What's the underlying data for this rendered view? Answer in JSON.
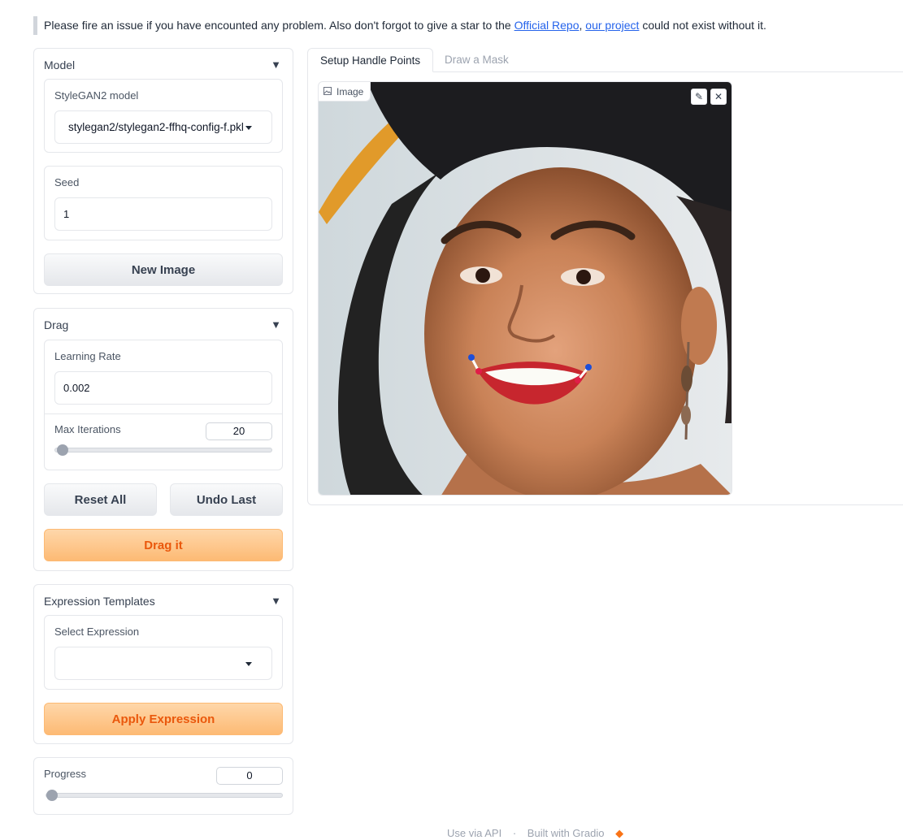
{
  "notice": {
    "before": "Please fire an issue if you have encounted any problem. Also don't forgot to give a star to the ",
    "link1": "Official Repo",
    "middle": ", ",
    "link2": "our project",
    "after": " could not exist without it."
  },
  "model_panel": {
    "title": "Model",
    "toggle": "▼",
    "stylegan_label": "StyleGAN2 model",
    "stylegan_value": "stylegan2/stylegan2-ffhq-config-f.pkl",
    "seed_label": "Seed",
    "seed_value": "1",
    "new_image_label": "New Image"
  },
  "drag_panel": {
    "title": "Drag",
    "toggle": "▼",
    "lr_label": "Learning Rate",
    "lr_value": "0.002",
    "max_iter_label": "Max Iterations",
    "max_iter_value": "20",
    "reset_label": "Reset All",
    "undo_label": "Undo Last",
    "drag_label": "Drag it"
  },
  "expr_panel": {
    "title": "Expression Templates",
    "toggle": "▼",
    "select_label": "Select Expression",
    "select_value": "",
    "apply_label": "Apply Expression"
  },
  "progress_panel": {
    "label": "Progress",
    "value": "0"
  },
  "tabs": [
    {
      "label": "Setup Handle Points",
      "active": true
    },
    {
      "label": "Draw a Mask",
      "active": false
    }
  ],
  "image_panel": {
    "label": "Image",
    "edit_icon": "pencil-icon",
    "close_icon": "close-icon"
  },
  "footer": {
    "api": "Use via API",
    "built": "Built with Gradio"
  },
  "colors": {
    "accent": "#ea580c",
    "handle_point": "#1d4ed8",
    "target_point": "#e11d48"
  }
}
